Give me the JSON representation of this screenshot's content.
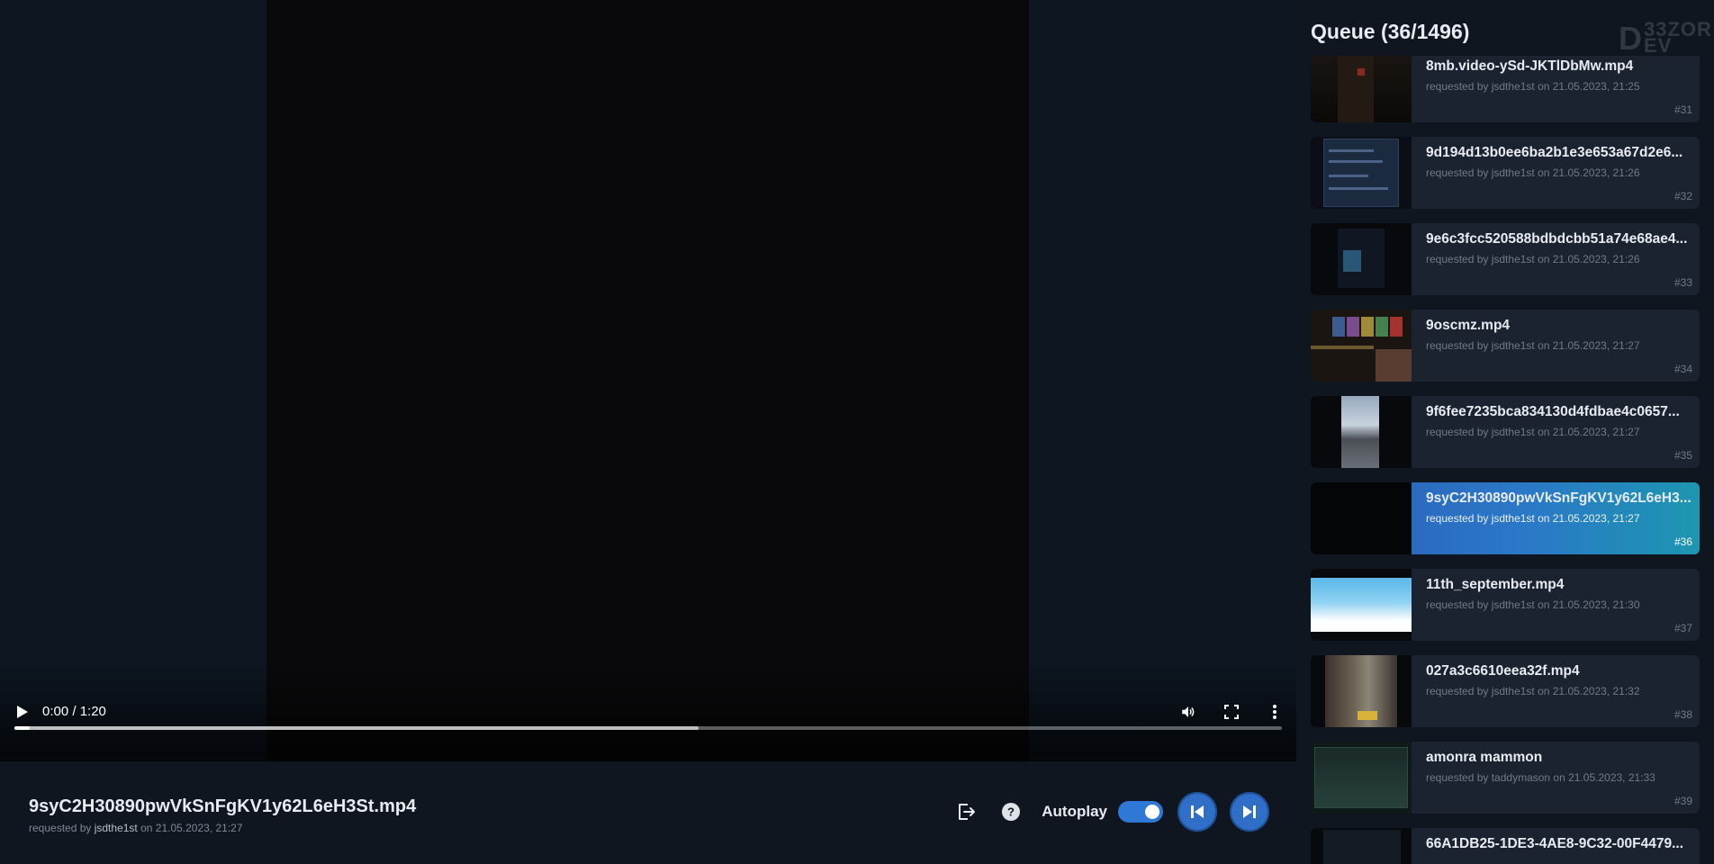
{
  "player": {
    "time": "0:00 / 1:20",
    "buffered_fraction": 0.54,
    "played_fraction": 0.012
  },
  "now_playing": {
    "title": "9syC2H30890pwVkSnFgKV1y62L6eH3St.mp4",
    "requested_by_prefix": "requested by ",
    "user": "jsdthe1st",
    "on_text": " on 21.05.2023, 21:27"
  },
  "actions": {
    "autoplay_label": "Autoplay",
    "autoplay_on": true
  },
  "queue": {
    "title": "Queue (36/1496)",
    "brand_line1": "33ZOR",
    "brand_line2": "EV",
    "items": [
      {
        "title": "8mb.video-ySd-JKTlDbMw.mp4",
        "sub": "requested by jsdthe1st on 21.05.2023, 21:25",
        "num": "#31",
        "thumb": "dark-door"
      },
      {
        "title": "9d194d13b0ee6ba2b1e3e653a67d2e6...",
        "sub": "requested by jsdthe1st on 21.05.2023, 21:26",
        "num": "#32",
        "thumb": "app"
      },
      {
        "title": "9e6c3fcc520588bdbdcbb51a74e68ae4...",
        "sub": "requested by jsdthe1st on 21.05.2023, 21:26",
        "num": "#33",
        "thumb": "web"
      },
      {
        "title": "9oscmz.mp4",
        "sub": "requested by jsdthe1st on 21.05.2023, 21:27",
        "num": "#34",
        "thumb": "grid"
      },
      {
        "title": "9f6fee7235bca834130d4fdbae4c0657...",
        "sub": "requested by jsdthe1st on 21.05.2023, 21:27",
        "num": "#35",
        "thumb": "street"
      },
      {
        "title": "9syC2H30890pwVkSnFgKV1y62L6eH3...",
        "sub": "requested by jsdthe1st on 21.05.2023, 21:27",
        "num": "#36",
        "thumb": "black",
        "active": true
      },
      {
        "title": "11th_september.mp4",
        "sub": "requested by jsdthe1st on 21.05.2023, 21:30",
        "num": "#37",
        "thumb": "sky"
      },
      {
        "title": "027a3c6610eea32f.mp4",
        "sub": "requested by jsdthe1st on 21.05.2023, 21:32",
        "num": "#38",
        "thumb": "city"
      },
      {
        "title": "amonra mammon",
        "sub": "requested by taddymason on 21.05.2023, 21:33",
        "num": "#39",
        "thumb": "game"
      },
      {
        "title": "66A1DB25-1DE3-4AE8-9C32-00F4479...",
        "sub": "",
        "num": "",
        "thumb": "doc"
      }
    ]
  },
  "icons": {
    "play": "play-icon",
    "volume": "volume-icon",
    "fullscreen": "fullscreen-icon",
    "more": "more-vertical-icon",
    "leave": "logout-icon",
    "help": "help-icon",
    "previous": "skip-previous-icon",
    "next": "skip-next-icon"
  },
  "colors": {
    "accent": "#2f6fc8",
    "active_item_gradient_start": "#2a5fb8",
    "active_item_gradient_end": "#1d96b0",
    "background": "#0f1620",
    "item_background": "#1b2330"
  }
}
